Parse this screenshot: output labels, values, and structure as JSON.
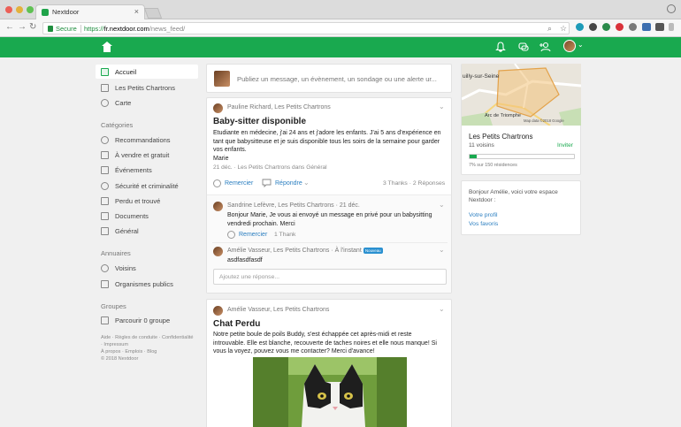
{
  "browser": {
    "tab_title": "Nextdoor",
    "tab_close": "×",
    "secure_label": "Secure",
    "url_scheme": "https://",
    "url_host": "fr.nextdoor.com",
    "url_path": "/news_feed/"
  },
  "sidebar": {
    "items": [
      {
        "label": "Accueil",
        "icon": "home-icon"
      },
      {
        "label": "Les Petits Chartrons",
        "icon": "neighborhood-icon"
      },
      {
        "label": "Carte",
        "icon": "map-pin-icon"
      }
    ],
    "categories_heading": "Catégories",
    "categories": [
      {
        "label": "Recommandations",
        "icon": "heart-icon"
      },
      {
        "label": "À vendre et gratuit",
        "icon": "tag-icon"
      },
      {
        "label": "Événements",
        "icon": "calendar-icon"
      },
      {
        "label": "Sécurité et criminalité",
        "icon": "shield-icon"
      },
      {
        "label": "Perdu et trouvé",
        "icon": "lost-found-icon"
      },
      {
        "label": "Documents",
        "icon": "document-icon"
      },
      {
        "label": "Général",
        "icon": "general-icon"
      }
    ],
    "annuaires_heading": "Annuaires",
    "annuaires": [
      {
        "label": "Voisins",
        "icon": "neighbors-icon"
      },
      {
        "label": "Organismes publics",
        "icon": "building-icon"
      }
    ],
    "groupes_heading": "Groupes",
    "groupes": [
      {
        "label": "Parcourir 0 groupe",
        "icon": "groups-icon"
      }
    ],
    "footer_line1": "Aide · Règles de conduite · Confidentialité",
    "footer_line2": "· Impressum",
    "footer_line3": "À propos · Emplois · Blog",
    "footer_line4": "© 2018 Nextdoor"
  },
  "composer": {
    "placeholder": "Publiez un message, un évènement, un sondage ou une alerte ur..."
  },
  "post1": {
    "author": "Pauline Richard, Les Petits Chartrons",
    "title": "Baby-sitter disponible",
    "body": "Etudiante en médecine, j'ai 24 ans et j'adore les enfants. J'ai 5 ans d'expérience en tant que babysitteuse et je suis disponible tous les soirs de la semaine pour garder vos enfants.",
    "signature": "Marie",
    "date": "21 déc. · Les Petits Chartrons dans Général",
    "action_thank": "Remercier",
    "action_reply": "Répondre",
    "stats": "3 Thanks · 2 Réponses"
  },
  "reply1": {
    "author": "Sandrine Lefèvre, Les Petits Chartrons · 21 déc.",
    "text": "Bonjour Marie, Je vous ai envoyé un message en privé pour un babysitting vendredi prochain. Merci",
    "action_thank": "Remercier",
    "thanks": "1 Thank"
  },
  "reply2": {
    "author": "Amélie Vasseur, Les Petits Chartrons · À l'instant",
    "badge": "Nouveau",
    "text": "asdfasdfasdf"
  },
  "reply_input": {
    "placeholder": "Ajoutez une réponse..."
  },
  "post2": {
    "author": "Amélie Vasseur, Les Petits Chartrons",
    "title": "Chat Perdu",
    "body": "Notre petite boule de poils Buddy, s'est échappée cet après-midi et reste introuvable. Elle est blanche, recouverte de taches noires et elle nous manque! Si vous la voyez, pouvez vous me contacter? Merci d'avance!"
  },
  "right": {
    "map_label_town": "uilly-sur-Seine",
    "map_label_place": "Arc de Triomphe",
    "map_label_copy": "Map data ©2018 Google",
    "neighborhood": "Les Petits Chartrons",
    "neighbors": "11 voisins",
    "invite": "Inviter",
    "progress_fraction": 0.07,
    "progress_note": "7% sur 150 résidences",
    "welcome": "Bonjour Amélie, voici votre espace Nextdoor :",
    "link_profile": "Votre profil",
    "link_favorites": "Vos favoris"
  },
  "colors": {
    "brand_green": "#19a94f",
    "link_blue": "#2a7ec0"
  }
}
